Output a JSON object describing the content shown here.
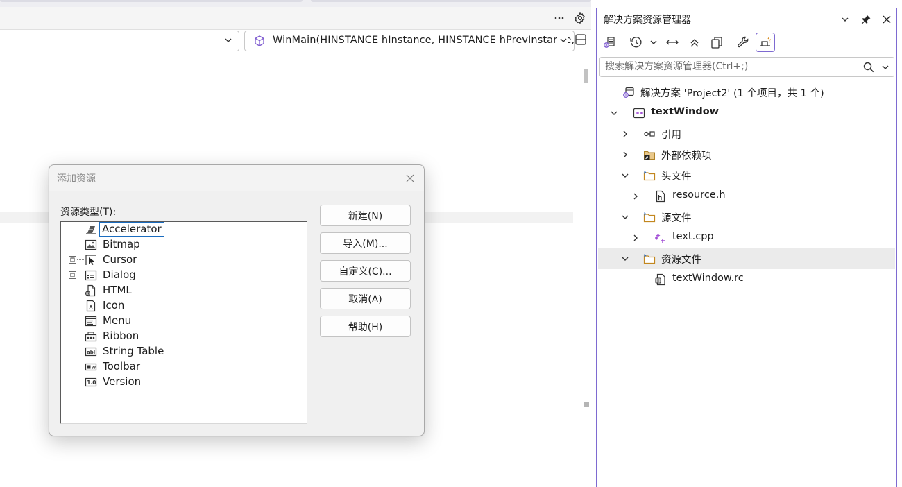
{
  "editor": {
    "member_dropdown": "WinMain(HINSTANCE hInstance, HINSTANCE hPrevInstance, LPSTR lpCmdLine, int nCmdShow)"
  },
  "dialog": {
    "title": "添加资源",
    "type_label": "资源类型(T):",
    "resource_types": [
      {
        "label": "Accelerator",
        "icon": "accelerator-icon",
        "expandable": false,
        "selected": true
      },
      {
        "label": "Bitmap",
        "icon": "bitmap-icon",
        "expandable": false
      },
      {
        "label": "Cursor",
        "icon": "cursor-icon",
        "expandable": true
      },
      {
        "label": "Dialog",
        "icon": "dialog-icon",
        "expandable": true
      },
      {
        "label": "HTML",
        "icon": "html-icon",
        "expandable": false
      },
      {
        "label": "Icon",
        "icon": "icon-resource-icon",
        "expandable": false
      },
      {
        "label": "Menu",
        "icon": "menu-icon",
        "expandable": false
      },
      {
        "label": "Ribbon",
        "icon": "ribbon-icon",
        "expandable": false
      },
      {
        "label": "String Table",
        "icon": "string-table-icon",
        "expandable": false
      },
      {
        "label": "Toolbar",
        "icon": "toolbar-icon",
        "expandable": false
      },
      {
        "label": "Version",
        "icon": "version-icon",
        "expandable": false
      }
    ],
    "buttons": {
      "new": "新建(N)",
      "import": "导入(M)...",
      "custom": "自定义(C)...",
      "cancel": "取消(A)",
      "help": "帮助(H)"
    }
  },
  "solution_explorer": {
    "title": "解决方案资源管理器",
    "search_placeholder": "搜索解决方案资源管理器(Ctrl+;)",
    "accent_color": "#7e6ad1",
    "tree": [
      {
        "label": "解决方案 'Project2' (1 个项目，共 1 个)",
        "icon": "solution-icon",
        "level": 0,
        "chevron": "none"
      },
      {
        "label": "textWindow",
        "icon": "cpp-project-icon",
        "level": 0,
        "chevron": "expanded",
        "bold": true
      },
      {
        "label": "引用",
        "icon": "references-icon",
        "level": 1,
        "chevron": "collapsed"
      },
      {
        "label": "外部依赖项",
        "icon": "external-deps-icon",
        "level": 1,
        "chevron": "collapsed"
      },
      {
        "label": "头文件",
        "icon": "filter-folder-icon",
        "level": 1,
        "chevron": "expanded"
      },
      {
        "label": "resource.h",
        "icon": "header-file-icon",
        "level": 2,
        "chevron": "collapsed"
      },
      {
        "label": "源文件",
        "icon": "filter-folder-icon",
        "level": 1,
        "chevron": "expanded"
      },
      {
        "label": "text.cpp",
        "icon": "cpp-file-icon",
        "level": 2,
        "chevron": "collapsed"
      },
      {
        "label": "资源文件",
        "icon": "filter-folder-icon",
        "level": 1,
        "chevron": "expanded",
        "selected": true
      },
      {
        "label": "textWindow.rc",
        "icon": "rc-file-icon",
        "level": 2,
        "chevron": "none"
      }
    ]
  }
}
